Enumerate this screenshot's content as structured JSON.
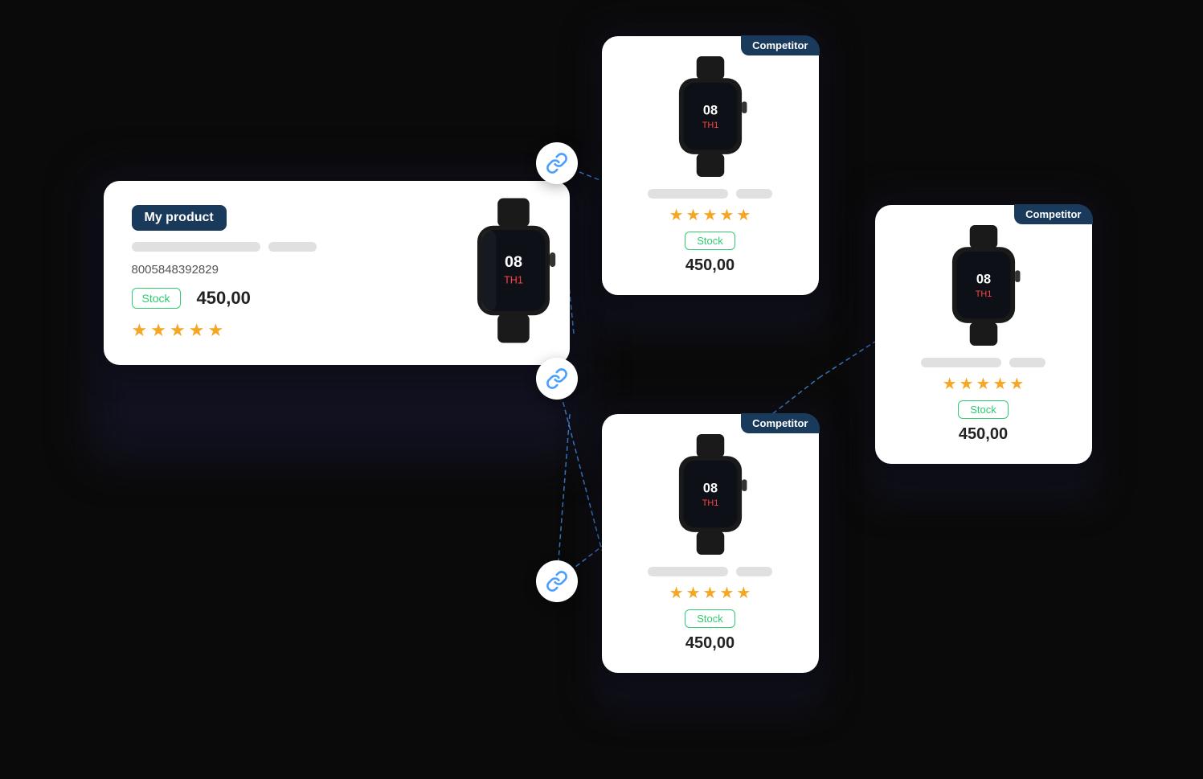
{
  "myProduct": {
    "badge": "My product",
    "barcode": "8005848392829",
    "stockLabel": "Stock",
    "price": "450,00",
    "stars": 4.5
  },
  "competitors": [
    {
      "id": 1,
      "badge": "Competitor",
      "stockLabel": "Stock",
      "price": "450,00",
      "stars": 4.5
    },
    {
      "id": 2,
      "badge": "Competitor",
      "stockLabel": "Stock",
      "price": "450,00",
      "stars": 4.5
    },
    {
      "id": 3,
      "badge": "Competitor",
      "stockLabel": "Stock",
      "price": "450,00",
      "stars": 4.5
    }
  ],
  "linkIcon": "🔗"
}
